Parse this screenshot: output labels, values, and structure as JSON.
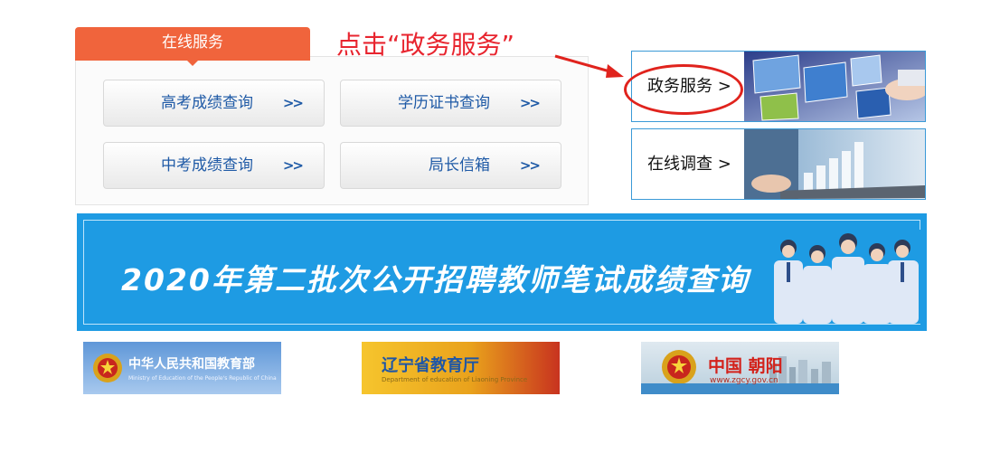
{
  "annotation": {
    "text": "点击“政务服务”"
  },
  "services": {
    "tab_label": "在线服务",
    "buttons": [
      {
        "label": "高考成绩查询",
        "arrow": ">>"
      },
      {
        "label": "学历证书查询",
        "arrow": ">>"
      },
      {
        "label": "中考成绩查询",
        "arrow": ">>"
      },
      {
        "label": "局长信箱",
        "arrow": ">>"
      }
    ]
  },
  "cards": [
    {
      "label": "政务服务 >"
    },
    {
      "label": "在线调查 >"
    }
  ],
  "banner": {
    "title": "2020年第二批次公开招聘教师笔试成绩查询"
  },
  "footer_links": [
    {
      "title": "中华人民共和国教育部",
      "subtitle": "Ministry of Education of the People's Republic of China"
    },
    {
      "title": "辽宁省教育厅",
      "subtitle": "Department of education of Liaoning Province"
    },
    {
      "title": "中国 朝阳",
      "subtitle": "www.zgcy.gov.cn"
    }
  ],
  "colors": {
    "accent": "#f0643c",
    "link_blue": "#1f5aa6",
    "banner_blue": "#1e9be3",
    "annotation_red": "#e0231d"
  }
}
